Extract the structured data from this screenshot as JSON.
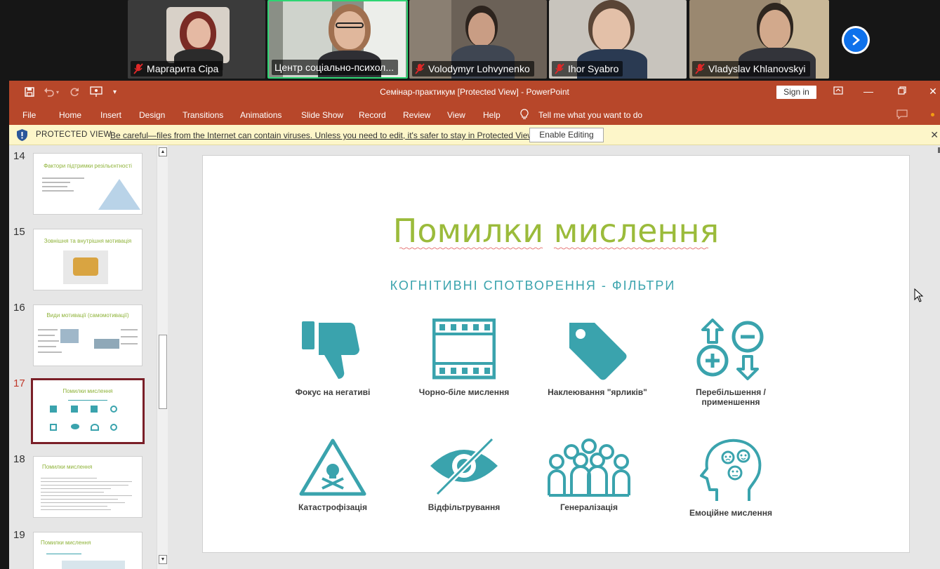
{
  "participants": [
    {
      "name": "Маргарита Сіра",
      "muted": true
    },
    {
      "name": "Центр соціально-психол...",
      "muted": false
    },
    {
      "name": "Volodymyr Lohvynenko",
      "muted": true
    },
    {
      "name": "Ihor Syabro",
      "muted": true
    },
    {
      "name": "Vladyslav Khlanovskyi",
      "muted": true
    }
  ],
  "ppt": {
    "window_title": "Семінар-практикум [Protected View]  -  PowerPoint",
    "sign_in": "Sign in",
    "tabs": [
      "File",
      "Home",
      "Insert",
      "Design",
      "Transitions",
      "Animations",
      "Slide Show",
      "Record",
      "Review",
      "View",
      "Help"
    ],
    "tell_me": "Tell me what you want to do",
    "protected_label": "PROTECTED VIEW",
    "protected_msg": "Be careful—files from the Internet can contain viruses. Unless you need to edit, it's safer to stay in Protected View.",
    "enable_editing": "Enable Editing"
  },
  "thumbnails": [
    {
      "num": "14",
      "title": "Фактори підтримки резільєнтності"
    },
    {
      "num": "15",
      "title": "Зовнішня та внутрішня мотивація"
    },
    {
      "num": "16",
      "title": "Види мотивації (самомотивації)"
    },
    {
      "num": "17",
      "title": "Помилки мислення",
      "selected": true
    },
    {
      "num": "18",
      "title": "Помилки мислення"
    },
    {
      "num": "19",
      "title": "Помилки мислення"
    }
  ],
  "slide": {
    "title": "Помилки мислення",
    "subtitle": "КОГНІТИВНІ СПОТВОРЕННЯ - ФІЛЬТРИ",
    "items": [
      {
        "icon": "thumbs-down-icon",
        "label": "Фокус на негативі"
      },
      {
        "icon": "film-strip-icon",
        "label": "Чорно-біле мислення"
      },
      {
        "icon": "tag-icon",
        "label": "Наклеювання \"ярликів\""
      },
      {
        "icon": "plus-minus-arrows-icon",
        "label": "Перебільшення /применшення"
      },
      {
        "icon": "hazard-skull-icon",
        "label": "Катастрофізація"
      },
      {
        "icon": "crossed-eye-icon",
        "label": "Відфільтрування"
      },
      {
        "icon": "crowd-icon",
        "label": "Генералізація"
      },
      {
        "icon": "emotional-head-icon",
        "label": "Емоційне мислення"
      }
    ],
    "accent_color": "#3aa3ad",
    "title_color": "#9bbb3b"
  }
}
